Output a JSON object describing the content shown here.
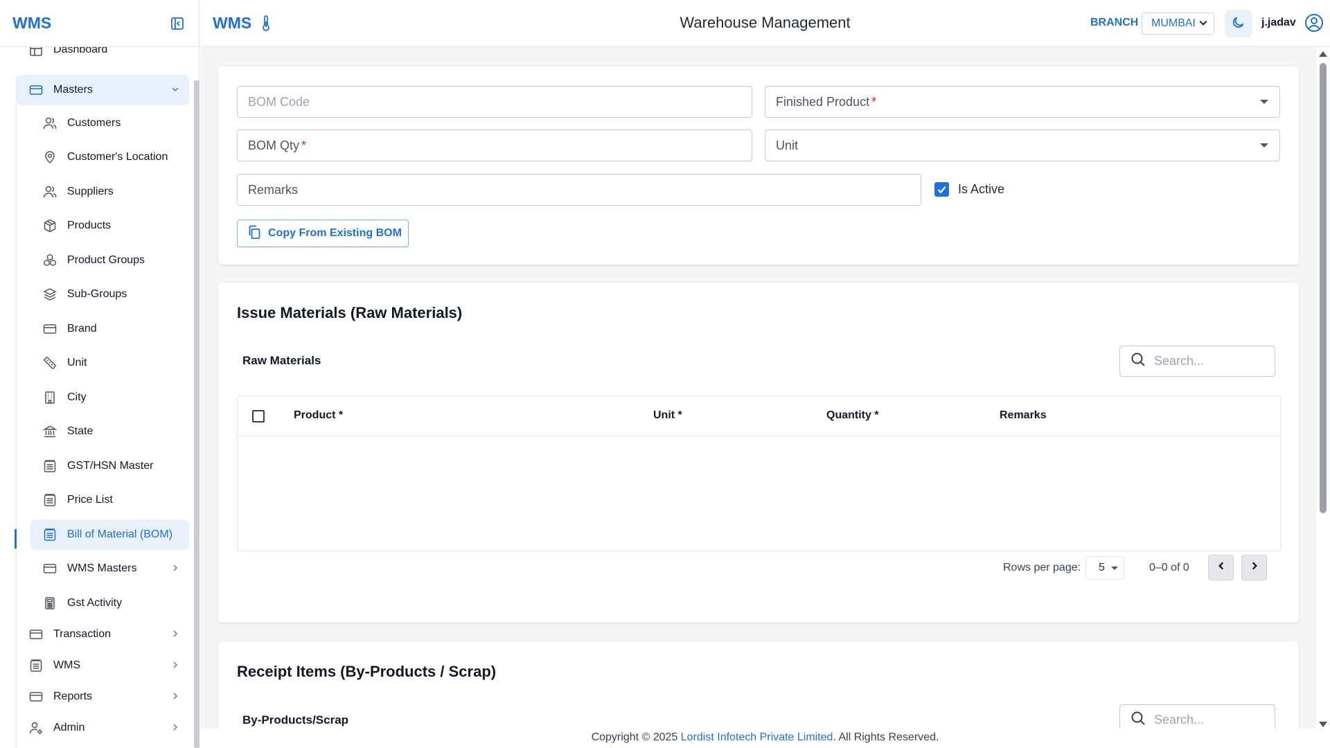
{
  "app": {
    "logo": "WMS",
    "title": "Warehouse Management",
    "branch_label": "BRANCH",
    "branch_value": "MUMBAI",
    "username": "j.jadav"
  },
  "sidebar": {
    "partial_item": "Dashboard",
    "masters_label": "Masters",
    "masters_items": [
      {
        "label": "Customers",
        "icon": "users-icon"
      },
      {
        "label": "Customer's Location",
        "icon": "location-pin-icon"
      },
      {
        "label": "Suppliers",
        "icon": "users-icon"
      },
      {
        "label": "Products",
        "icon": "box-icon"
      },
      {
        "label": "Product Groups",
        "icon": "group-icon"
      },
      {
        "label": "Sub-Groups",
        "icon": "layers-icon"
      },
      {
        "label": "Brand",
        "icon": "card-icon"
      },
      {
        "label": "Unit",
        "icon": "ruler-icon"
      },
      {
        "label": "City",
        "icon": "building-icon"
      },
      {
        "label": "State",
        "icon": "bank-icon"
      },
      {
        "label": "GST/HSN Master",
        "icon": "archive-icon"
      },
      {
        "label": "Price List",
        "icon": "archive-icon"
      },
      {
        "label": "Bill of Material (BOM)",
        "icon": "archive-icon",
        "active": true
      },
      {
        "label": "WMS Masters",
        "icon": "card-icon",
        "has_children": true
      },
      {
        "label": "Gst Activity",
        "icon": "calculator-icon"
      }
    ],
    "top_items": [
      {
        "label": "Transaction",
        "icon": "card-icon"
      },
      {
        "label": "WMS",
        "icon": "archive-icon"
      },
      {
        "label": "Reports",
        "icon": "card-icon"
      },
      {
        "label": "Admin",
        "icon": "user-gear-icon"
      }
    ]
  },
  "form": {
    "bom_code_placeholder": "BOM Code",
    "finished_product_label": "Finished Product",
    "bom_qty_label": "BOM Qty",
    "required_mark": "*",
    "unit_label": "Unit",
    "remarks_label": "Remarks",
    "is_active_label": "Is Active",
    "is_active": true,
    "copy_button": "Copy From Existing BOM"
  },
  "issue_section": {
    "title": "Issue Materials (Raw Materials)",
    "table_title": "Raw Materials",
    "search_placeholder": "Search...",
    "columns": [
      "Product *",
      "Unit *",
      "Quantity *",
      "Remarks"
    ],
    "rows": [],
    "rows_per_page_label": "Rows per page:",
    "rows_per_page": "5",
    "range": "0–0 of 0"
  },
  "receipt_section": {
    "title": "Receipt Items (By-Products / Scrap)",
    "table_title": "By-Products/Scrap",
    "search_placeholder": "Search..."
  },
  "footer": {
    "prefix": "Copyright © 2025 ",
    "company": "Lordist Infotech Private Limited",
    "suffix": ". All Rights Reserved."
  },
  "colors": {
    "accent": "#1e6fd9",
    "active_bg": "#e7f0fb",
    "required": "#dc2626",
    "page_bg": "#f3f4f6"
  }
}
